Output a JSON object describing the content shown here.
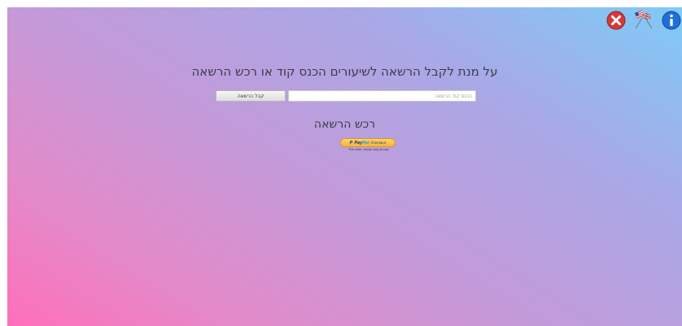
{
  "header": {
    "close_icon": "close-icon",
    "language_icon": "language-flags-icon",
    "info_icon": "info-icon",
    "colors": {
      "close": "#d33a3a",
      "info": "#1f6fd6"
    }
  },
  "main": {
    "title": "על מנת לקבל הרשאה לשיעורים הכנס קוד או רכש הרשאה",
    "code_input": {
      "placeholder": "הכנס קוד הרשאה",
      "value": ""
    },
    "code_button_label": "קבל הרשאה",
    "purchase_title": "רכש הרשאה",
    "paypal": {
      "logo_pay": "Pay",
      "logo_pal": "Pal",
      "checkout_label": "Checkout",
      "tagline": "The safer, easier way to pay"
    }
  }
}
